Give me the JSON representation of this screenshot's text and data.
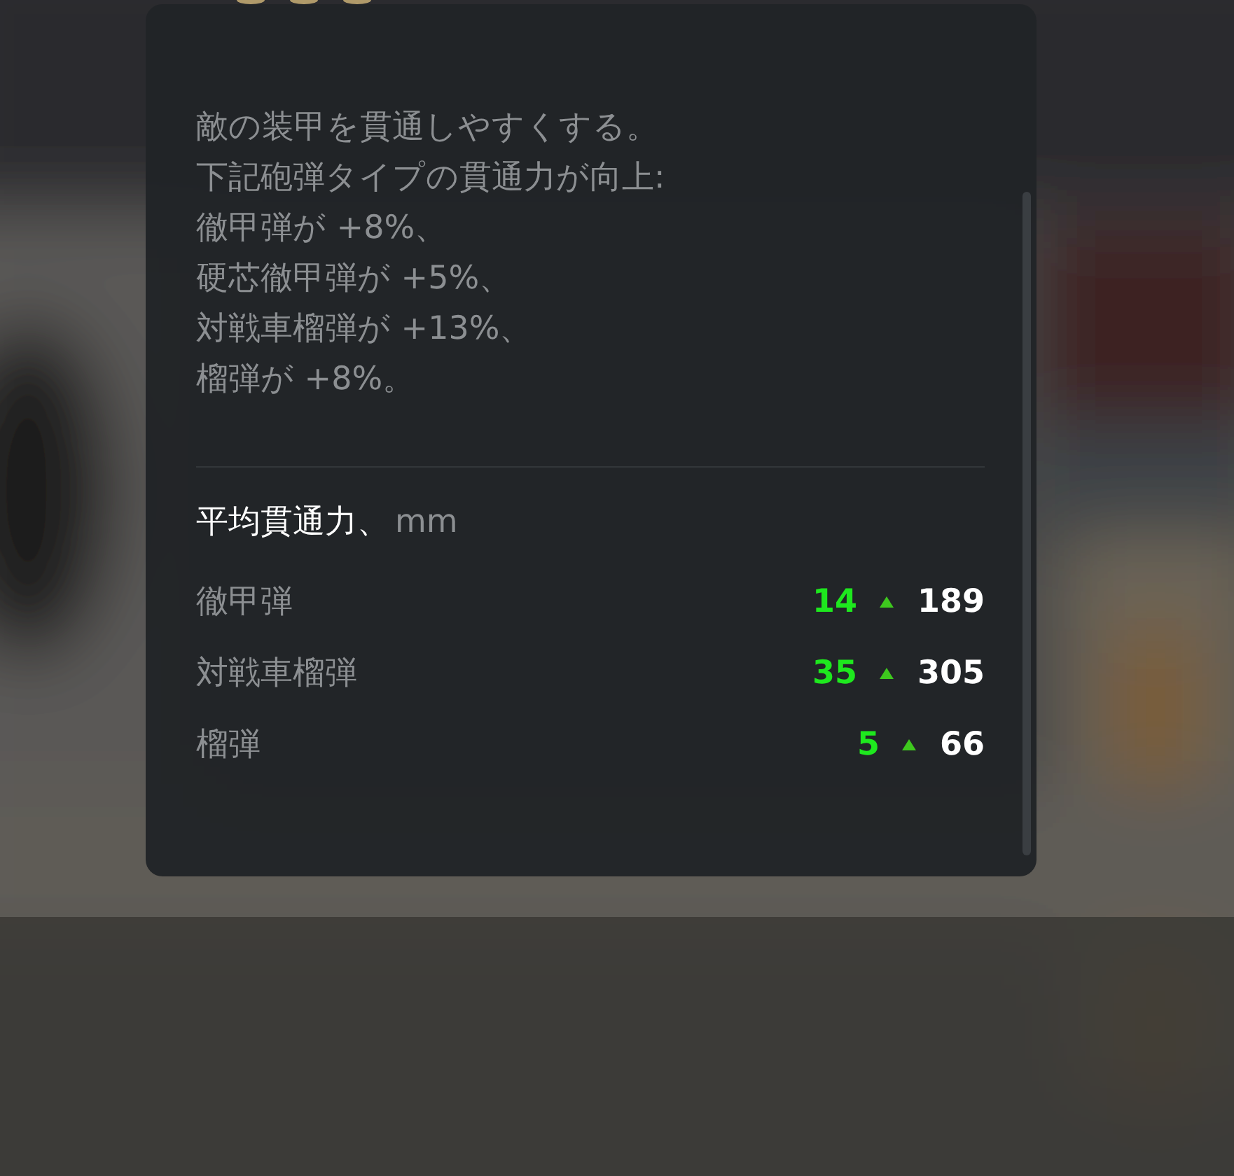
{
  "description": [
    "敵の装甲を貫通しやすくする。",
    "下記砲弾タイプの貫通力が向上:",
    "徹甲弾が +8%、",
    "硬芯徹甲弾が +5%、",
    "対戦車榴弾が +13%、",
    "榴弾が +8%。"
  ],
  "stats": {
    "title": "平均貫通力、",
    "unit": "mm",
    "rows": [
      {
        "name": "徹甲弾",
        "bonus": "14",
        "total": "189"
      },
      {
        "name": "対戦車榴弾",
        "bonus": "35",
        "total": "305"
      },
      {
        "name": "榴弾",
        "bonus": "5",
        "total": "66"
      }
    ]
  }
}
